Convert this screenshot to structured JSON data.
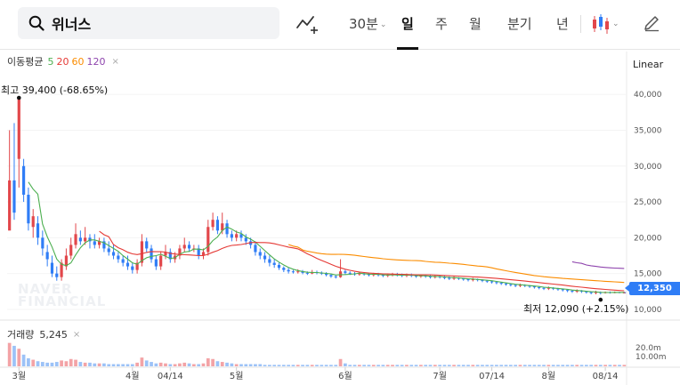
{
  "search": {
    "value": "위너스"
  },
  "periods": [
    {
      "label": "30분",
      "has_caret": true,
      "active": false
    },
    {
      "label": "일",
      "active": true
    },
    {
      "label": "주",
      "active": false
    },
    {
      "label": "월",
      "active": false
    },
    {
      "label": "분기",
      "active": false
    },
    {
      "label": "년",
      "active": false
    }
  ],
  "moving_average": {
    "label": "이동평균",
    "periods": [
      {
        "value": "5",
        "color": "#4caf50"
      },
      {
        "value": "20",
        "color": "#e53935"
      },
      {
        "value": "60",
        "color": "#fb8c00"
      },
      {
        "value": "120",
        "color": "#8e44ad"
      }
    ],
    "close_symbol": "×"
  },
  "scale_mode": "Linear",
  "volume_legend": {
    "label": "거래량",
    "value": "5,245",
    "close_symbol": "×"
  },
  "watermark": {
    "line1": "NAVER",
    "line2": "FINANCIAL"
  },
  "annotations": {
    "high": "최고 39,400 (-68.65%)",
    "low": "최저 12,090 (+2.15%)"
  },
  "last_price": "12,350",
  "colors": {
    "up": "#e2474b",
    "down": "#2f7df6",
    "ma5": "#4caf50",
    "ma20": "#e53935",
    "ma60": "#fb8c00",
    "ma120": "#8e44ad",
    "accent": "#2f7df6"
  },
  "icons": [
    "search-icon",
    "drawing-tool-icon",
    "candlestick-type-icon",
    "pencil-icon"
  ],
  "chart_data": {
    "type": "candlestick",
    "y_ticks": [
      "40,000",
      "35,000",
      "30,000",
      "25,000",
      "20,000",
      "15,000",
      "10,000"
    ],
    "y_tick_values": [
      40000,
      35000,
      30000,
      25000,
      20000,
      15000,
      10000
    ],
    "ylim": [
      9000,
      43000
    ],
    "x_ticks": [
      "3월",
      "4월",
      "04/14",
      "5월",
      "6월",
      "7월",
      "07/14",
      "8월",
      "08/14"
    ],
    "x_tick_index": [
      2,
      26,
      34,
      48,
      71,
      91,
      102,
      114,
      126
    ],
    "volume_ticks": [
      "20.0m",
      "10.00m"
    ],
    "last_value": 12350,
    "high": 39400,
    "low": 12090,
    "candles": [
      [
        21000,
        28000,
        35000,
        22000
      ],
      [
        28000,
        23500,
        36000,
        22500
      ],
      [
        31000,
        39400,
        39400,
        27000
      ],
      [
        30000,
        26000,
        31000,
        25000
      ],
      [
        26000,
        22000,
        27000,
        21000
      ],
      [
        21500,
        23000,
        24000,
        20000
      ],
      [
        22000,
        20000,
        23000,
        19000
      ],
      [
        20000,
        18500,
        21000,
        17500
      ],
      [
        18000,
        17000,
        19000,
        16000
      ],
      [
        16500,
        15000,
        17500,
        14500
      ],
      [
        15000,
        14500,
        16000,
        14000
      ],
      [
        14500,
        16500,
        17000,
        14000
      ],
      [
        16000,
        17500,
        18500,
        15500
      ],
      [
        17500,
        19000,
        20000,
        17000
      ],
      [
        19000,
        20500,
        22000,
        18500
      ],
      [
        20000,
        19500,
        21000,
        19000
      ],
      [
        19500,
        20000,
        21500,
        19000
      ],
      [
        20000,
        19500,
        20500,
        18500
      ],
      [
        19500,
        19000,
        20500,
        18500
      ],
      [
        19000,
        19500,
        20000,
        18500
      ],
      [
        19500,
        18500,
        20000,
        18000
      ],
      [
        18500,
        18000,
        19500,
        17500
      ],
      [
        18000,
        17500,
        19000,
        17000
      ],
      [
        17500,
        17000,
        18000,
        16500
      ],
      [
        17000,
        16500,
        17500,
        16000
      ],
      [
        16500,
        16000,
        17500,
        15500
      ],
      [
        16000,
        15500,
        16500,
        15000
      ],
      [
        15500,
        16500,
        17000,
        15000
      ],
      [
        16500,
        19500,
        20500,
        16000
      ],
      [
        19500,
        18500,
        20000,
        18000
      ],
      [
        18500,
        17000,
        19000,
        16500
      ],
      [
        17000,
        16000,
        17500,
        15500
      ],
      [
        16000,
        17500,
        18000,
        15500
      ],
      [
        17500,
        18000,
        19000,
        17000
      ],
      [
        18000,
        17000,
        18500,
        16500
      ],
      [
        17000,
        17500,
        18000,
        16500
      ],
      [
        17500,
        18500,
        19000,
        17000
      ],
      [
        18500,
        19000,
        20000,
        18000
      ],
      [
        19000,
        18500,
        19500,
        18000
      ],
      [
        18500,
        18500,
        19000,
        18000
      ],
      [
        18500,
        17500,
        19000,
        17000
      ],
      [
        17500,
        18000,
        18500,
        17000
      ],
      [
        18000,
        21500,
        22500,
        17500
      ],
      [
        21500,
        22500,
        23500,
        21000
      ],
      [
        22500,
        21000,
        23000,
        20500
      ],
      [
        21000,
        22000,
        23500,
        20500
      ],
      [
        22000,
        20500,
        22500,
        20000
      ],
      [
        20500,
        20000,
        21000,
        19500
      ],
      [
        20000,
        20500,
        21000,
        19500
      ],
      [
        20500,
        20000,
        21000,
        19500
      ],
      [
        20000,
        19500,
        20500,
        19000
      ],
      [
        19500,
        19000,
        20000,
        18500
      ],
      [
        19000,
        18000,
        19500,
        17500
      ],
      [
        18000,
        17500,
        18500,
        17000
      ],
      [
        17500,
        17000,
        18000,
        16500
      ],
      [
        17000,
        16500,
        17500,
        16000
      ],
      [
        16500,
        16200,
        17000,
        15800
      ],
      [
        16200,
        15800,
        16500,
        15500
      ],
      [
        15800,
        15500,
        16000,
        15200
      ],
      [
        15500,
        15300,
        15800,
        15000
      ],
      [
        15300,
        15200,
        15500,
        15000
      ],
      [
        15200,
        15300,
        15600,
        15000
      ],
      [
        15300,
        15100,
        15500,
        14900
      ],
      [
        15100,
        15000,
        15300,
        14800
      ],
      [
        15000,
        15200,
        15500,
        14900
      ],
      [
        15200,
        15100,
        15400,
        14900
      ],
      [
        15100,
        15000,
        15300,
        14800
      ],
      [
        15000,
        14800,
        15200,
        14600
      ],
      [
        14800,
        14600,
        15000,
        14400
      ],
      [
        14600,
        14500,
        14800,
        14300
      ],
      [
        14500,
        15300,
        17000,
        14400
      ],
      [
        15300,
        15100,
        15500,
        14900
      ],
      [
        15100,
        15000,
        15300,
        14800
      ],
      [
        15000,
        14900,
        15200,
        14700
      ],
      [
        14900,
        15000,
        15200,
        14700
      ],
      [
        15000,
        14900,
        15200,
        14700
      ],
      [
        14900,
        14800,
        15100,
        14600
      ],
      [
        14800,
        14900,
        15100,
        14600
      ],
      [
        14900,
        14800,
        15100,
        14600
      ],
      [
        14800,
        14700,
        15000,
        14500
      ],
      [
        14700,
        14800,
        15000,
        14500
      ],
      [
        14800,
        14900,
        15100,
        14600
      ],
      [
        14900,
        14800,
        15100,
        14600
      ],
      [
        14800,
        14700,
        15000,
        14500
      ],
      [
        14700,
        14800,
        15000,
        14500
      ],
      [
        14800,
        14700,
        15000,
        14500
      ],
      [
        14700,
        14600,
        14900,
        14400
      ],
      [
        14600,
        14700,
        14900,
        14400
      ],
      [
        14700,
        14600,
        14800,
        14400
      ],
      [
        14600,
        14500,
        14800,
        14300
      ],
      [
        14500,
        14600,
        14800,
        14300
      ],
      [
        14600,
        14500,
        14700,
        14300
      ],
      [
        14500,
        14400,
        14700,
        14200
      ],
      [
        14400,
        14300,
        14600,
        14100
      ],
      [
        14300,
        14400,
        14600,
        14100
      ],
      [
        14400,
        14300,
        14500,
        14100
      ],
      [
        14300,
        14200,
        14400,
        14000
      ],
      [
        14200,
        14100,
        14300,
        13900
      ],
      [
        14100,
        14200,
        14400,
        13900
      ],
      [
        14200,
        14100,
        14300,
        13900
      ],
      [
        14100,
        14000,
        14200,
        13800
      ],
      [
        14000,
        13900,
        14100,
        13700
      ],
      [
        13900,
        13800,
        14000,
        13600
      ],
      [
        13800,
        13700,
        13900,
        13500
      ],
      [
        13700,
        13600,
        13800,
        13400
      ],
      [
        13600,
        13500,
        13700,
        13300
      ],
      [
        13500,
        13400,
        13600,
        13200
      ],
      [
        13400,
        13300,
        13500,
        13100
      ],
      [
        13300,
        13400,
        13600,
        13100
      ],
      [
        13400,
        13300,
        13500,
        13100
      ],
      [
        13300,
        13200,
        13400,
        13000
      ],
      [
        13200,
        13100,
        13300,
        12900
      ],
      [
        13100,
        13000,
        13200,
        12800
      ],
      [
        13000,
        12900,
        13100,
        12700
      ],
      [
        12900,
        13000,
        13200,
        12700
      ],
      [
        13000,
        12900,
        13100,
        12700
      ],
      [
        12900,
        12800,
        13000,
        12600
      ],
      [
        12800,
        12700,
        12900,
        12500
      ],
      [
        12700,
        12600,
        12800,
        12400
      ],
      [
        12600,
        12500,
        12700,
        12300
      ],
      [
        12500,
        12600,
        12800,
        12300
      ],
      [
        12600,
        12500,
        12700,
        12300
      ],
      [
        12500,
        12400,
        12600,
        12200
      ],
      [
        12400,
        12300,
        12500,
        12100
      ],
      [
        12300,
        12400,
        12600,
        12100
      ],
      [
        12400,
        12300,
        12500,
        12090
      ],
      [
        12300,
        12400,
        12500,
        12200
      ],
      [
        12400,
        12350,
        12500,
        12200
      ],
      [
        12350,
        12400,
        12500,
        12250
      ],
      [
        12400,
        12350,
        12450,
        12250
      ],
      [
        12350,
        12350,
        12450,
        12300
      ]
    ],
    "volume": [
      3.2,
      2.8,
      2.4,
      1.6,
      1.1,
      0.9,
      0.7,
      0.6,
      0.5,
      0.5,
      0.6,
      0.8,
      0.7,
      1.0,
      0.9,
      0.6,
      0.5,
      0.5,
      0.4,
      0.4,
      0.4,
      0.3,
      0.3,
      0.3,
      0.3,
      0.3,
      0.3,
      0.5,
      1.2,
      0.8,
      0.6,
      0.4,
      0.5,
      0.4,
      0.3,
      0.3,
      0.4,
      0.5,
      0.4,
      0.3,
      0.3,
      0.4,
      1.1,
      1.0,
      0.7,
      0.6,
      0.5,
      0.4,
      0.3,
      0.3,
      0.3,
      0.3,
      0.3,
      0.3,
      0.2,
      0.2,
      0.2,
      0.2,
      0.2,
      0.2,
      0.2,
      0.2,
      0.2,
      0.2,
      0.2,
      0.2,
      0.2,
      0.2,
      0.2,
      0.2,
      1.0,
      0.4,
      0.2,
      0.2,
      0.2,
      0.2,
      0.2,
      0.2,
      0.2,
      0.2,
      0.2,
      0.2,
      0.2,
      0.2,
      0.2,
      0.2,
      0.2,
      0.2,
      0.2,
      0.2,
      0.2,
      0.2,
      0.2,
      0.2,
      0.2,
      0.2,
      0.2,
      0.2,
      0.2,
      0.2,
      0.2,
      0.2,
      0.2,
      0.2,
      0.2,
      0.2,
      0.2,
      0.2,
      0.2,
      0.2,
      0.2,
      0.2,
      0.2,
      0.2,
      0.2,
      0.2,
      0.2,
      0.2,
      0.2,
      0.2,
      0.2,
      0.2,
      0.2,
      0.2,
      0.2,
      0.2,
      0.2,
      0.2,
      0.2,
      0.2,
      0.2
    ]
  }
}
